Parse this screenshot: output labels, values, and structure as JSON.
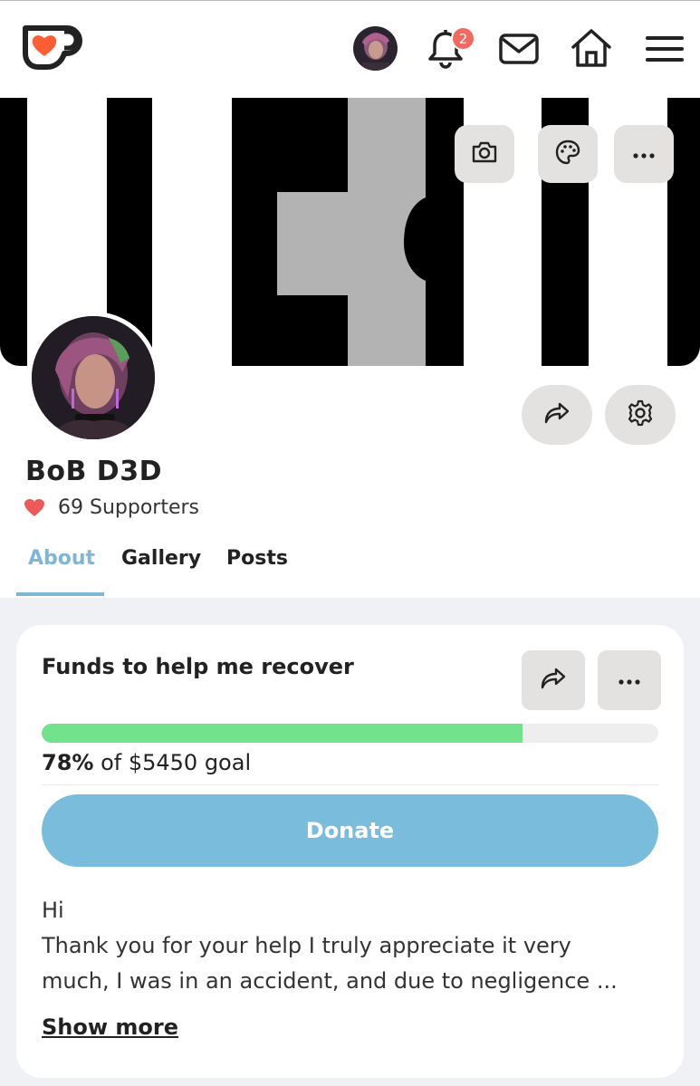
{
  "header": {
    "notification_count": "2"
  },
  "banner": {
    "buttons": [
      "camera",
      "palette",
      "more"
    ]
  },
  "profile": {
    "name": "BoB D3D",
    "supporters": "69 Supporters"
  },
  "tabs": [
    {
      "label": "About",
      "active": true
    },
    {
      "label": "Gallery",
      "active": false
    },
    {
      "label": "Posts",
      "active": false
    }
  ],
  "goal_card": {
    "title": "Funds to help me recover",
    "progress_percent": 78,
    "percent_label": "78%",
    "goal_text": " of $5450 goal",
    "donate_label": "Donate",
    "description_lines": [
      "Hi",
      "Thank you for your help I truly appreciate it very",
      "much, I was in an accident, and due to negligence ..."
    ],
    "show_more_label": "Show more"
  },
  "colors": {
    "accent": "#79bcdc",
    "progress": "#72e38c",
    "badge": "#f26a5f",
    "heart": "#ee5a5a",
    "logo_orange": "#ff5e34"
  },
  "icons": [
    "kofi-logo-icon",
    "bell-icon",
    "mail-icon",
    "home-icon",
    "menu-icon",
    "camera-icon",
    "palette-icon",
    "ellipsis-icon",
    "share-icon",
    "gear-icon",
    "heart-icon"
  ]
}
